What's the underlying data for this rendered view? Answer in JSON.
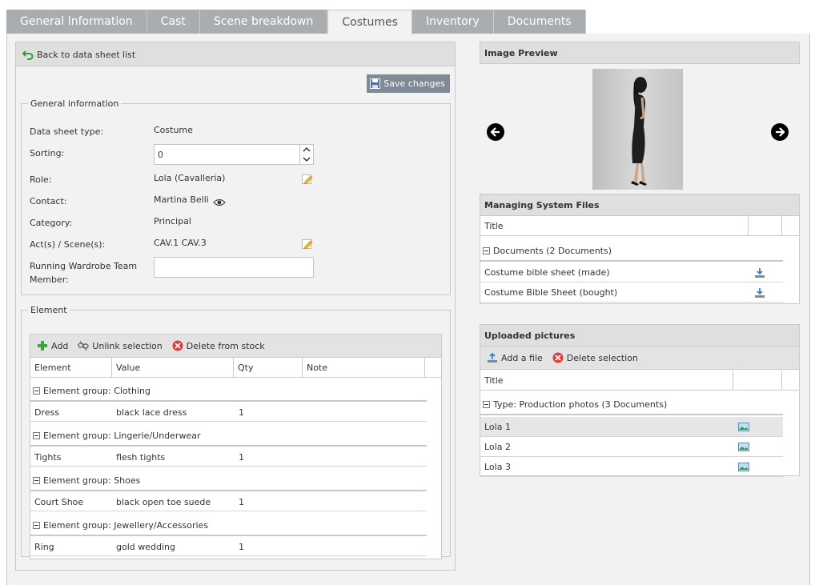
{
  "tabs": [
    {
      "label": "General Information"
    },
    {
      "label": "Cast"
    },
    {
      "label": "Scene breakdown"
    },
    {
      "label": "Costumes"
    },
    {
      "label": "Inventory"
    },
    {
      "label": "Documents"
    }
  ],
  "active_tab": "Costumes",
  "toolbar": {
    "back_label": "Back to data sheet list",
    "save_label": "Save changes"
  },
  "general_info": {
    "legend": "General information",
    "fields": {
      "type_label": "Data sheet type:",
      "type_value": "Costume",
      "sorting_label": "Sorting:",
      "sorting_value": "0",
      "role_label": "Role:",
      "role_value": "Lola (Cavalleria)",
      "contact_label": "Contact:",
      "contact_value": "Martina Belli",
      "category_label": "Category:",
      "category_value": "Principal",
      "acts_label": "Act(s) / Scene(s):",
      "acts_value": "CAV.1 CAV.3",
      "team_label_1": "Running Wardrobe Team",
      "team_label_2": "Member:",
      "team_value": ""
    }
  },
  "element": {
    "legend": "Element",
    "toolbar": {
      "add": "Add",
      "unlink": "Unlink selection",
      "delete": "Delete from stock"
    },
    "columns": [
      "Element",
      "Value",
      "Qty",
      "Note"
    ],
    "groups": [
      {
        "label": "Element group: Clothing",
        "rows": [
          {
            "element": "Dress",
            "value": "black lace dress",
            "qty": "1",
            "note": ""
          }
        ]
      },
      {
        "label": "Element group: Lingerie/Underwear",
        "rows": [
          {
            "element": "Tights",
            "value": "flesh tights",
            "qty": "1",
            "note": ""
          }
        ]
      },
      {
        "label": "Element group: Shoes",
        "rows": [
          {
            "element": "Court Shoe",
            "value": "black open toe suede",
            "qty": "1",
            "note": ""
          }
        ]
      },
      {
        "label": "Element group: Jewellery/Accessories",
        "rows": [
          {
            "element": "Ring",
            "value": "gold wedding",
            "qty": "1",
            "note": ""
          }
        ]
      }
    ]
  },
  "image_preview": {
    "title": "Image Preview"
  },
  "system_files": {
    "title": "Managing System Files",
    "column": "Title",
    "group": "Documents (2 Documents)",
    "rows": [
      {
        "title": "Costume bible sheet (made)"
      },
      {
        "title": "Costume Bible Sheet (bought)"
      }
    ]
  },
  "uploaded": {
    "title": "Uploaded pictures",
    "toolbar": {
      "add": "Add a file",
      "delete": "Delete selection"
    },
    "column": "Title",
    "group": "Type: Production photos (3 Documents)",
    "rows": [
      {
        "title": "Lola 1"
      },
      {
        "title": "Lola 2"
      },
      {
        "title": "Lola 3"
      }
    ]
  },
  "colors": {
    "tab_bg": "#a9adaf",
    "save_btn": "#7e8a98",
    "panel_bg": "#f2f2f2",
    "header_bg": "#dfdfdf"
  }
}
